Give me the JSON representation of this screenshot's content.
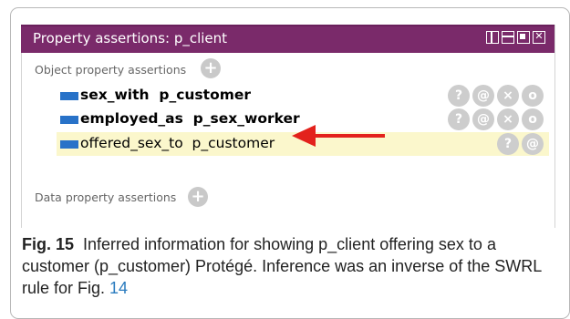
{
  "panel": {
    "title": "Property assertions: p_client",
    "window_buttons": [
      "split-vertical-icon",
      "split-horizontal-icon",
      "maximize-icon",
      "close-icon"
    ]
  },
  "object_section": {
    "label": "Object property assertions",
    "rows": [
      {
        "property": "sex_with",
        "value": "p_customer",
        "bold": true,
        "buttons": [
          "?",
          "@",
          "×",
          "o"
        ]
      },
      {
        "property": "employed_as",
        "value": "p_sex_worker",
        "bold": true,
        "buttons": [
          "?",
          "@",
          "×",
          "o"
        ]
      },
      {
        "property": "offered_sex_to",
        "value": "p_customer",
        "bold": false,
        "highlighted": true,
        "buttons": [
          "?",
          "@"
        ]
      }
    ]
  },
  "data_section": {
    "label": "Data property assertions"
  },
  "caption": {
    "fig_label": "Fig. 15",
    "text": "Inferred information for showing p_client offering sex to a customer (p_customer) Protégé. Inference was an inverse of the SWRL rule for Fig.",
    "fig_ref": "14"
  },
  "colors": {
    "title_bar": "#7a2a6a",
    "highlight_row": "#fbf7cc",
    "swatch": "#2872c8",
    "arrow": "#e3221c",
    "fig_ref": "#2a7bbf"
  }
}
